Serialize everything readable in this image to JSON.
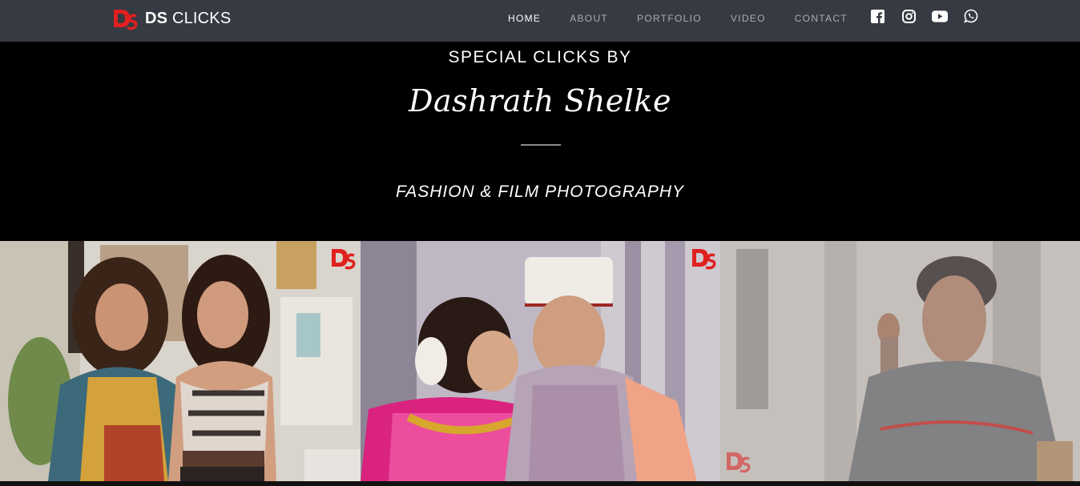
{
  "brand": {
    "bold": "DS",
    "light": " CLICKS",
    "logo": "ds-logo"
  },
  "nav": {
    "items": [
      {
        "label": "HOME",
        "active": true
      },
      {
        "label": "ABOUT",
        "active": false
      },
      {
        "label": "PORTFOLIO",
        "active": false
      },
      {
        "label": "VIDEO",
        "active": false
      },
      {
        "label": "CONTACT",
        "active": false
      }
    ],
    "social": [
      "facebook-icon",
      "instagram-icon",
      "youtube-icon",
      "whatsapp-icon"
    ]
  },
  "hero": {
    "kicker": "SPECIAL CLICKS BY",
    "name": "Dashrath Shelke",
    "tagline": "FASHION & FILM PHOTOGRAPHY"
  },
  "gallery": {
    "photos": [
      {
        "subject": "two-women-portrait"
      },
      {
        "subject": "wedding-couple"
      },
      {
        "subject": "man-in-dim-room"
      }
    ]
  },
  "colors": {
    "navbar": "#363a42",
    "accent": "#e0201f",
    "hero_bg": "#000000"
  }
}
